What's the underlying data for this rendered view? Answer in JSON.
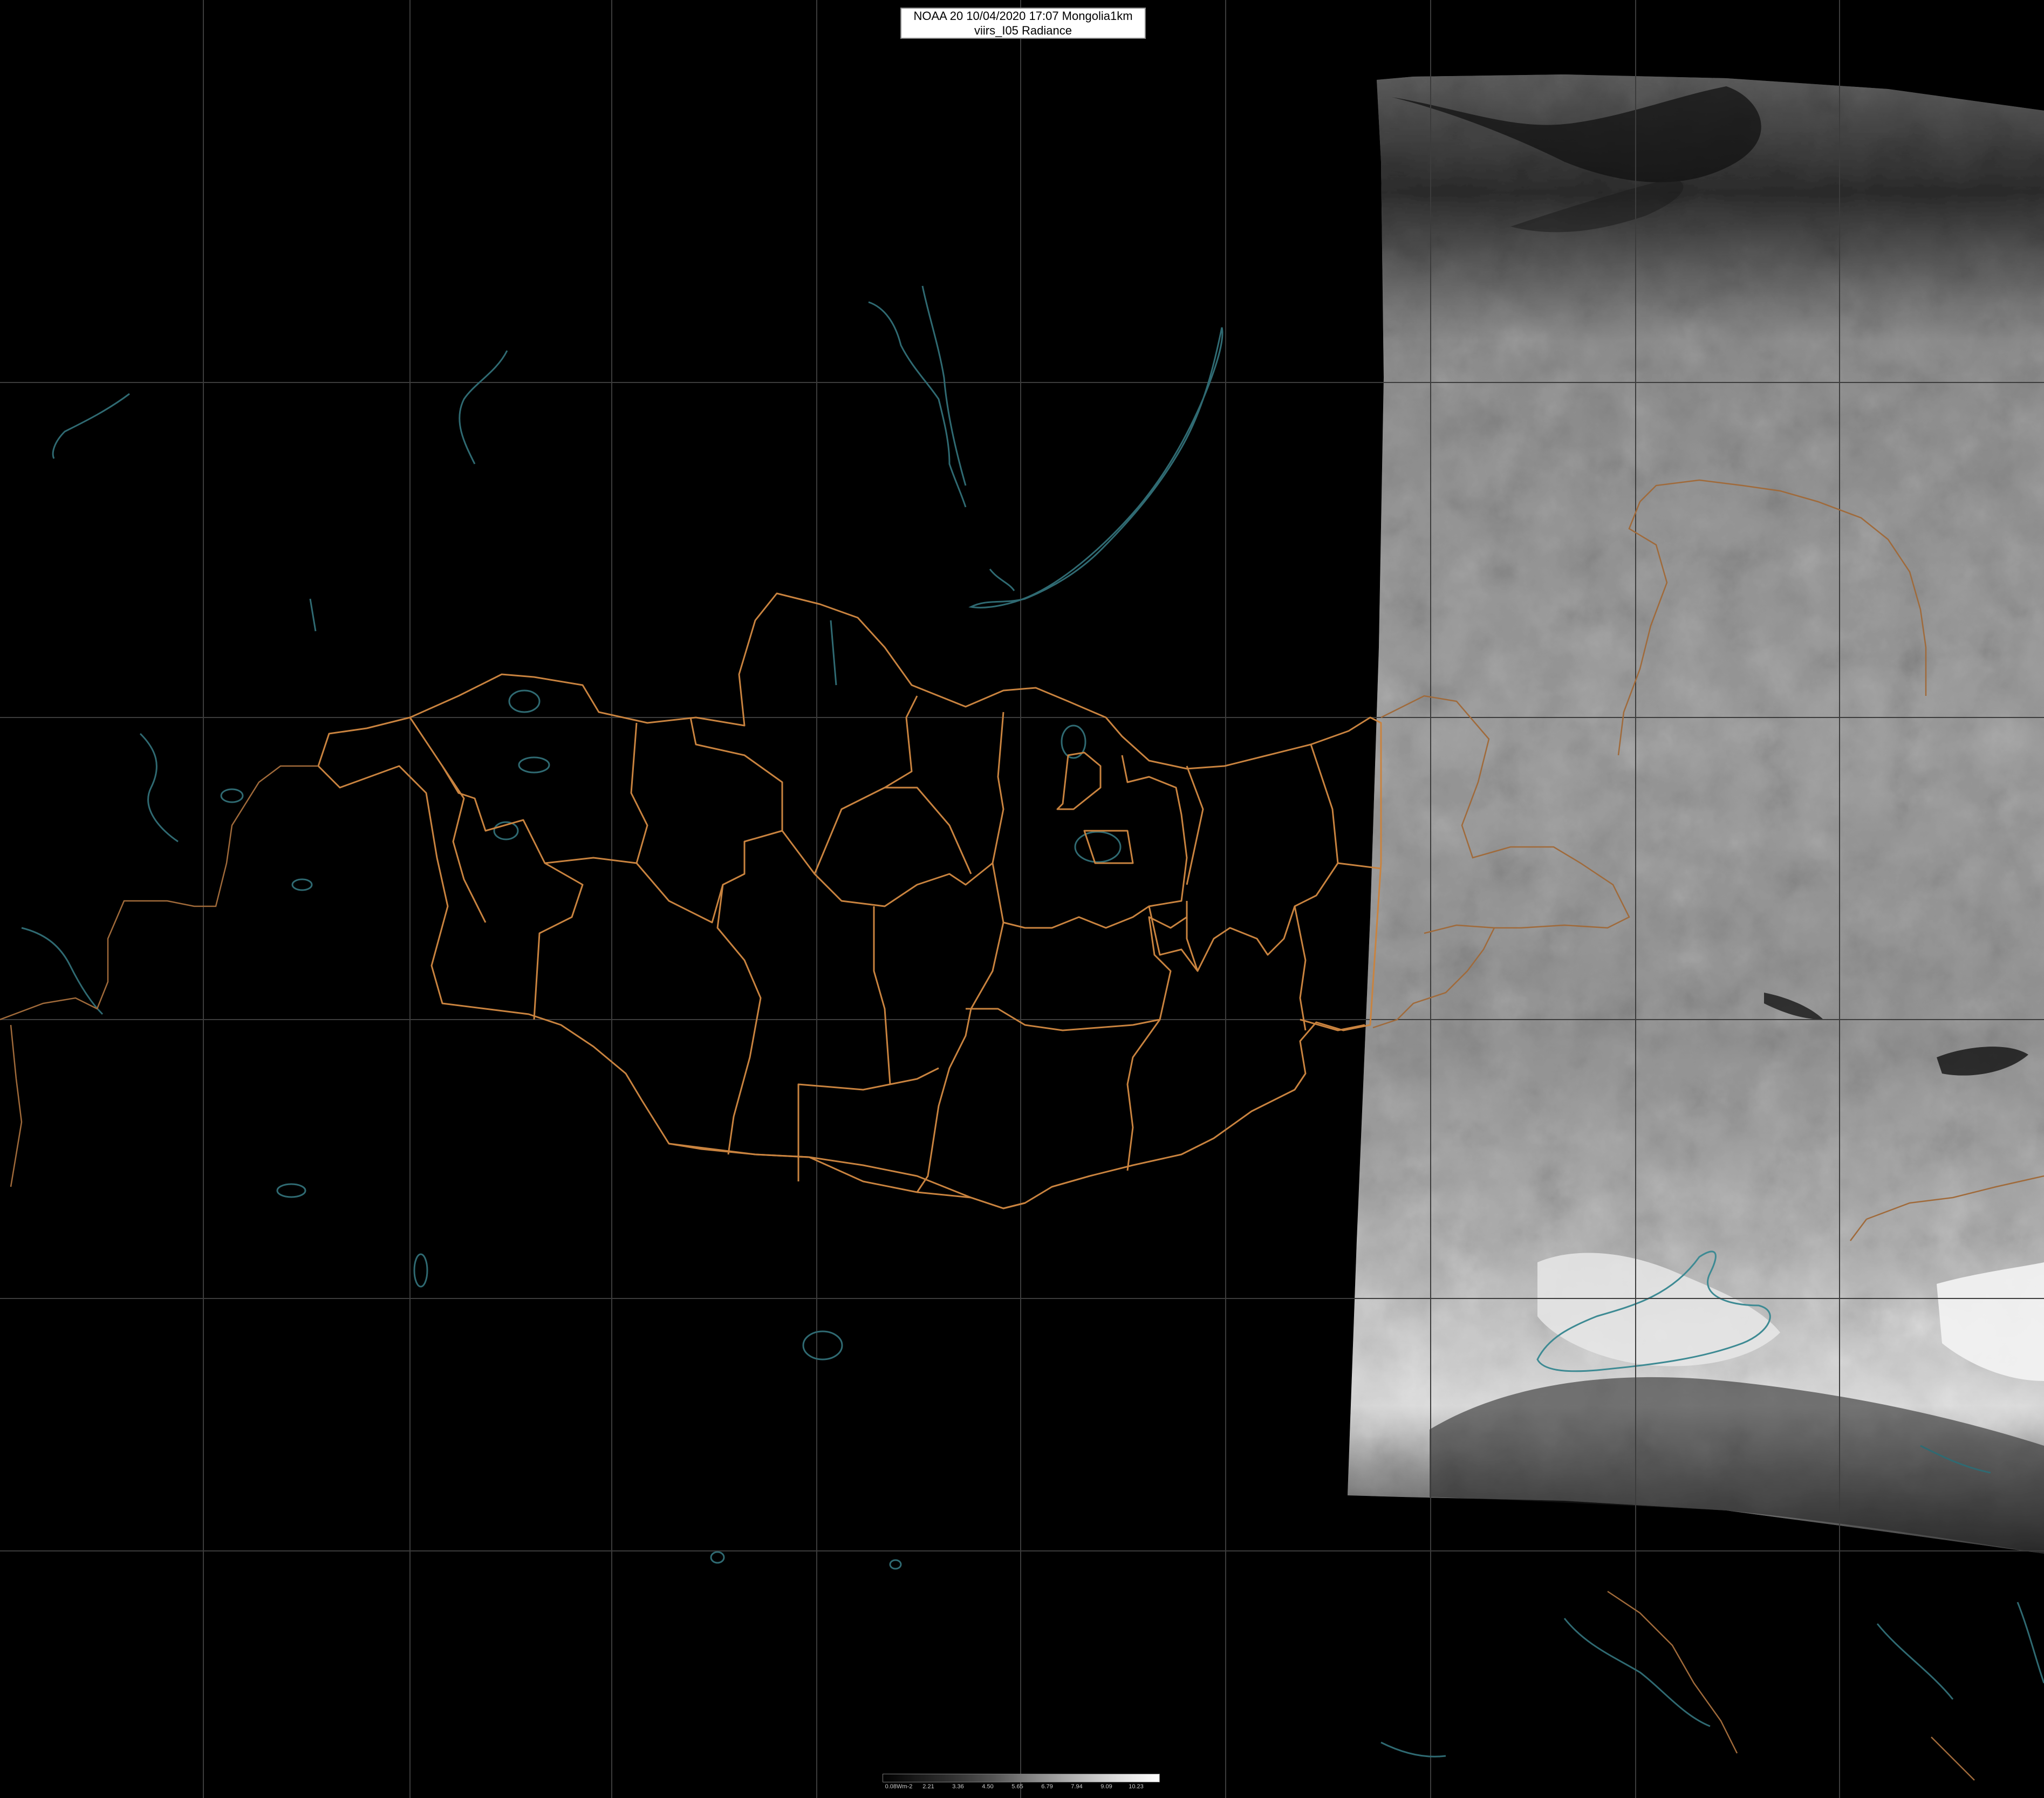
{
  "header": {
    "title_line1": "NOAA 20 10/04/2020 17:07 Mongolia1km",
    "title_line2": "viirs_I05 Radiance"
  },
  "colorbar": {
    "labels": [
      "0.08Wm-2",
      "2.21",
      "3.36",
      "4.50",
      "5.65",
      "6.79",
      "7.94",
      "9.09",
      "10.23"
    ],
    "colors": {
      "low": "#000000",
      "high": "#ffffff"
    }
  },
  "map": {
    "background": "#000000",
    "grid_color": "#3c3c3c",
    "border_color": "#c9833f",
    "water_color": "#2f6a72",
    "swath": "grayscale satellite radiance imagery on the right side"
  }
}
